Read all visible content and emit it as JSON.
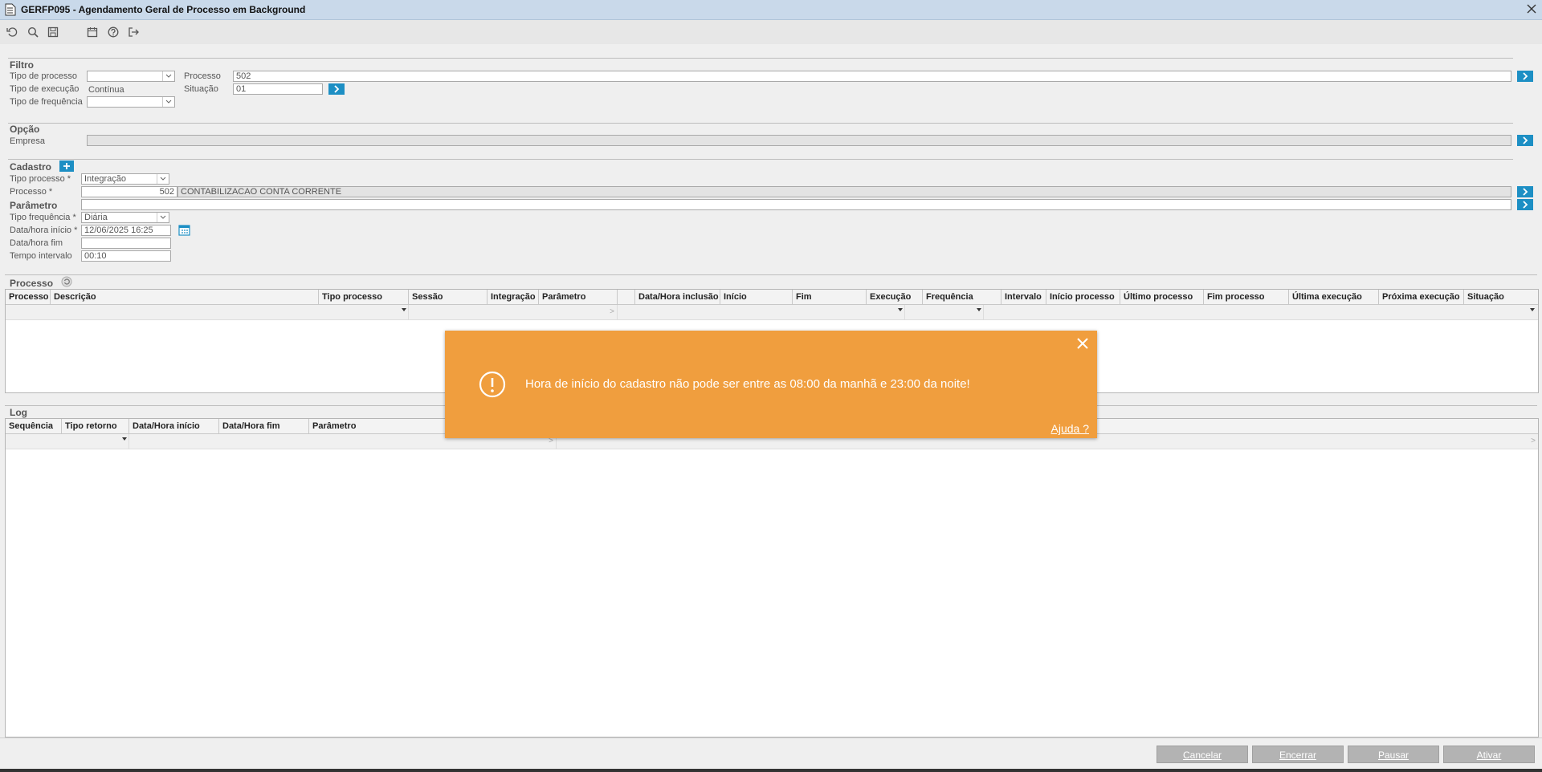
{
  "window": {
    "title": "GERFP095 - Agendamento Geral de Processo em Background"
  },
  "toolbar_icons": [
    "refresh-icon",
    "search-icon",
    "save-icon",
    "calendar-icon",
    "help-icon",
    "exit-icon"
  ],
  "filtro": {
    "title": "Filtro",
    "tipo_processo_label": "Tipo de processo",
    "tipo_execucao_label": "Tipo de execução",
    "tipo_execucao_value": "Contínua",
    "tipo_frequencia_label": "Tipo de frequência",
    "processo_label": "Processo",
    "processo_value": "502",
    "situacao_label": "Situação",
    "situacao_value": "01"
  },
  "opcao": {
    "title": "Opção",
    "empresa_label": "Empresa"
  },
  "cadastro": {
    "title": "Cadastro",
    "tipo_processo_label": "Tipo processo *",
    "tipo_processo_value": "Integração",
    "processo_label": "Processo *",
    "processo_code": "502",
    "processo_desc": "CONTABILIZACAO CONTA CORRENTE",
    "parametro_label": "Parâmetro",
    "tipo_frequencia_label": "Tipo frequência *",
    "tipo_frequencia_value": "Diária",
    "data_inicio_label": "Data/hora início *",
    "data_inicio_value": "12/06/2025 16:25",
    "data_fim_label": "Data/hora fim",
    "tempo_intervalo_label": "Tempo intervalo",
    "tempo_intervalo_value": "00:10"
  },
  "processo_grid": {
    "title": "Processo",
    "columns": [
      "Processo",
      "Descrição",
      "Tipo processo",
      "Sessão",
      "Integração",
      "Parâmetro",
      "",
      "Data/Hora inclusão",
      "Início",
      "Fim",
      "Execução",
      "Frequência",
      "Intervalo",
      "Início processo",
      "Último processo",
      "Fim processo",
      "Última execução",
      "Próxima execução",
      "Situação"
    ]
  },
  "log_grid": {
    "title": "Log",
    "columns": [
      "Sequência",
      "Tipo retorno",
      "Data/Hora início",
      "Data/Hora fim",
      "Parâmetro"
    ]
  },
  "toast": {
    "message": "Hora de início do cadastro não pode ser entre as 08:00 da manhã e 23:00 da noite!",
    "help_link": "Ajuda ?",
    "color": "#f09e3e"
  },
  "buttons": {
    "cancelar": "Cancelar",
    "encerrar": "Encerrar",
    "pausar": "Pausar",
    "ativar": "Ativar"
  }
}
